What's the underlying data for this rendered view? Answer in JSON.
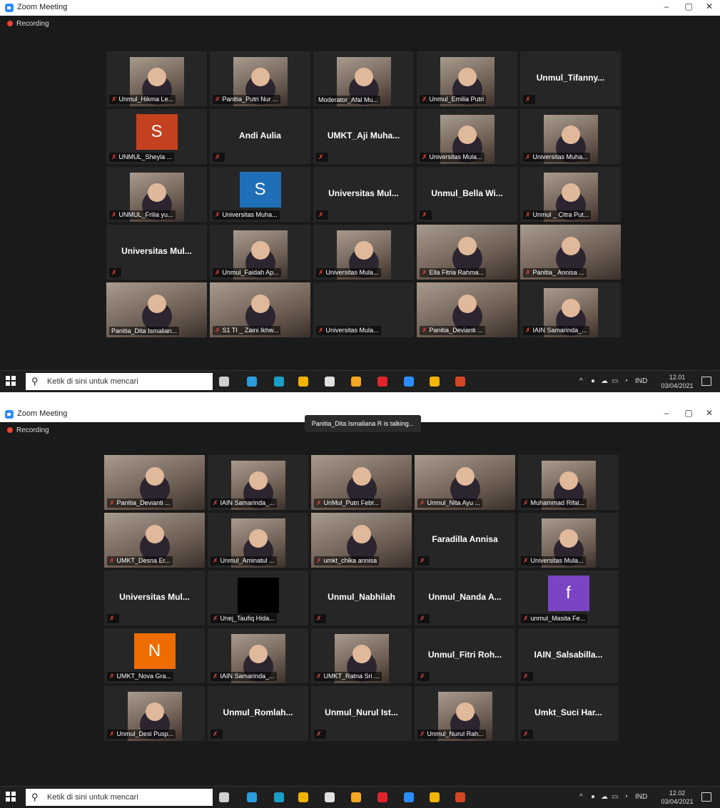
{
  "screens": [
    {
      "window_title": "Zoom Meeting",
      "recording_label": "Recording",
      "talking": "",
      "tiles": [
        {
          "name": "Unmul_Hikma Le...",
          "kind": "photo"
        },
        {
          "name": "Panitia_Putri Nur ...",
          "kind": "photo"
        },
        {
          "name": "Moderator_Afal Mu...",
          "kind": "photo",
          "nomic": true
        },
        {
          "name": "Unmul_Emilia Putri",
          "kind": "photo"
        },
        {
          "name": "",
          "kind": "text",
          "label": "Unmul_Tifanny..."
        },
        {
          "name": "UNMUL_Sheyla ...",
          "kind": "avatar",
          "letter": "S",
          "color": "#c4411f"
        },
        {
          "name": "",
          "kind": "text",
          "label": "Andi Aulia"
        },
        {
          "name": "",
          "kind": "text",
          "label": "UMKT_Aji Muha..."
        },
        {
          "name": "Universitas Mula...",
          "kind": "photo"
        },
        {
          "name": "Universitas Muha...",
          "kind": "photo"
        },
        {
          "name": "UNMUL_Frilia yu...",
          "kind": "photo"
        },
        {
          "name": "Universitas Muha...",
          "kind": "avatar",
          "letter": "S",
          "color": "#1f6fb8"
        },
        {
          "name": "",
          "kind": "text",
          "label": "Universitas Mul..."
        },
        {
          "name": "",
          "kind": "text",
          "label": "Unmul_Bella Wi..."
        },
        {
          "name": "Unmul _ Citra Put...",
          "kind": "photo"
        },
        {
          "name": "",
          "kind": "text",
          "label": "Universitas Mul..."
        },
        {
          "name": "Unmul_Faidah Ap...",
          "kind": "photo"
        },
        {
          "name": "Universitas Mula...",
          "kind": "photo"
        },
        {
          "name": "Ella Fitria Rahma...",
          "kind": "fullphoto"
        },
        {
          "name": "Panitia_ Annisa ...",
          "kind": "fullphoto"
        },
        {
          "name": "Panitia_Dita Ismalian...",
          "kind": "fullphoto",
          "active": true,
          "nomic": true
        },
        {
          "name": "S1 TI _ Zaini Ikhw...",
          "kind": "fullphoto"
        },
        {
          "name": "Universitas Mula...",
          "kind": "blank"
        },
        {
          "name": "Panitia_Devianti ...",
          "kind": "fullphoto"
        },
        {
          "name": "IAIN Samarinda_...",
          "kind": "photo"
        }
      ],
      "search_placeholder": "Ketik di sini untuk mencari",
      "lang": "IND",
      "time": "12.01",
      "date": "03/04/2021"
    },
    {
      "window_title": "Zoom Meeting",
      "recording_label": "Recording",
      "talking": "Panitia_Dita Ismaliana R is talking...",
      "tiles": [
        {
          "name": "Panitia_Devianti ...",
          "kind": "fullphoto"
        },
        {
          "name": "IAIN Samarinda_...",
          "kind": "photo"
        },
        {
          "name": "UnMul_Putri Febr...",
          "kind": "fullphoto"
        },
        {
          "name": "Unmul_Nita Ayu ...",
          "kind": "fullphoto"
        },
        {
          "name": "Muhammad Rifal...",
          "kind": "photo"
        },
        {
          "name": "UMKT_Desna Er...",
          "kind": "fullphoto"
        },
        {
          "name": "Unmul_Aminatul ...",
          "kind": "photo"
        },
        {
          "name": "umkt_chika annisa",
          "kind": "fullphoto"
        },
        {
          "name": "",
          "kind": "text",
          "label": "Faradilla Annisa"
        },
        {
          "name": "Universitas Mula...",
          "kind": "photo"
        },
        {
          "name": "",
          "kind": "text",
          "label": "Universitas Mul..."
        },
        {
          "name": "Unej_Taufiq Hida...",
          "kind": "dark"
        },
        {
          "name": "",
          "kind": "text",
          "label": "Unmul_Nabhilah"
        },
        {
          "name": "",
          "kind": "text",
          "label": "Unmul_Nanda A..."
        },
        {
          "name": "unmul_Masita Fe...",
          "kind": "avatar",
          "letter": "f",
          "color": "#7a44c4"
        },
        {
          "name": "UMKT_Nova Gra...",
          "kind": "avatar",
          "letter": "N",
          "color": "#ef6c00"
        },
        {
          "name": "IAIN Samarinda_...",
          "kind": "photo"
        },
        {
          "name": "UMKT_Ratna Sri ...",
          "kind": "photo"
        },
        {
          "name": "",
          "kind": "text",
          "label": "Unmul_Fitri Roh..."
        },
        {
          "name": "",
          "kind": "text",
          "label": "IAIN_Salsabilla..."
        },
        {
          "name": "Unmul_Desi Pusp...",
          "kind": "photo"
        },
        {
          "name": "",
          "kind": "text",
          "label": "Unmul_Romlah..."
        },
        {
          "name": "",
          "kind": "text",
          "label": "Unmul_Nurul Ist..."
        },
        {
          "name": "Unmul_Nurul Rah...",
          "kind": "photo"
        },
        {
          "name": "",
          "kind": "text",
          "label": "Umkt_Suci Har..."
        }
      ],
      "search_placeholder": "Ketik di sini untuk mencari",
      "lang": "IND",
      "time": "12.02",
      "date": "03/04/2021"
    }
  ],
  "icons": {
    "taskbar": [
      "task-view-icon",
      "mail-icon",
      "edge-icon",
      "file-explorer-icon",
      "store-icon",
      "paint-icon",
      "opera-icon",
      "zoom-icon",
      "chrome-icon",
      "powerpoint-icon"
    ],
    "taskbar_colors": [
      "#cfcfcf",
      "#2d9be0",
      "#1aa0c8",
      "#f0b400",
      "#e0e0e0",
      "#f5a623",
      "#e0242c",
      "#2d8cff",
      "#f4b400",
      "#d24726"
    ]
  }
}
